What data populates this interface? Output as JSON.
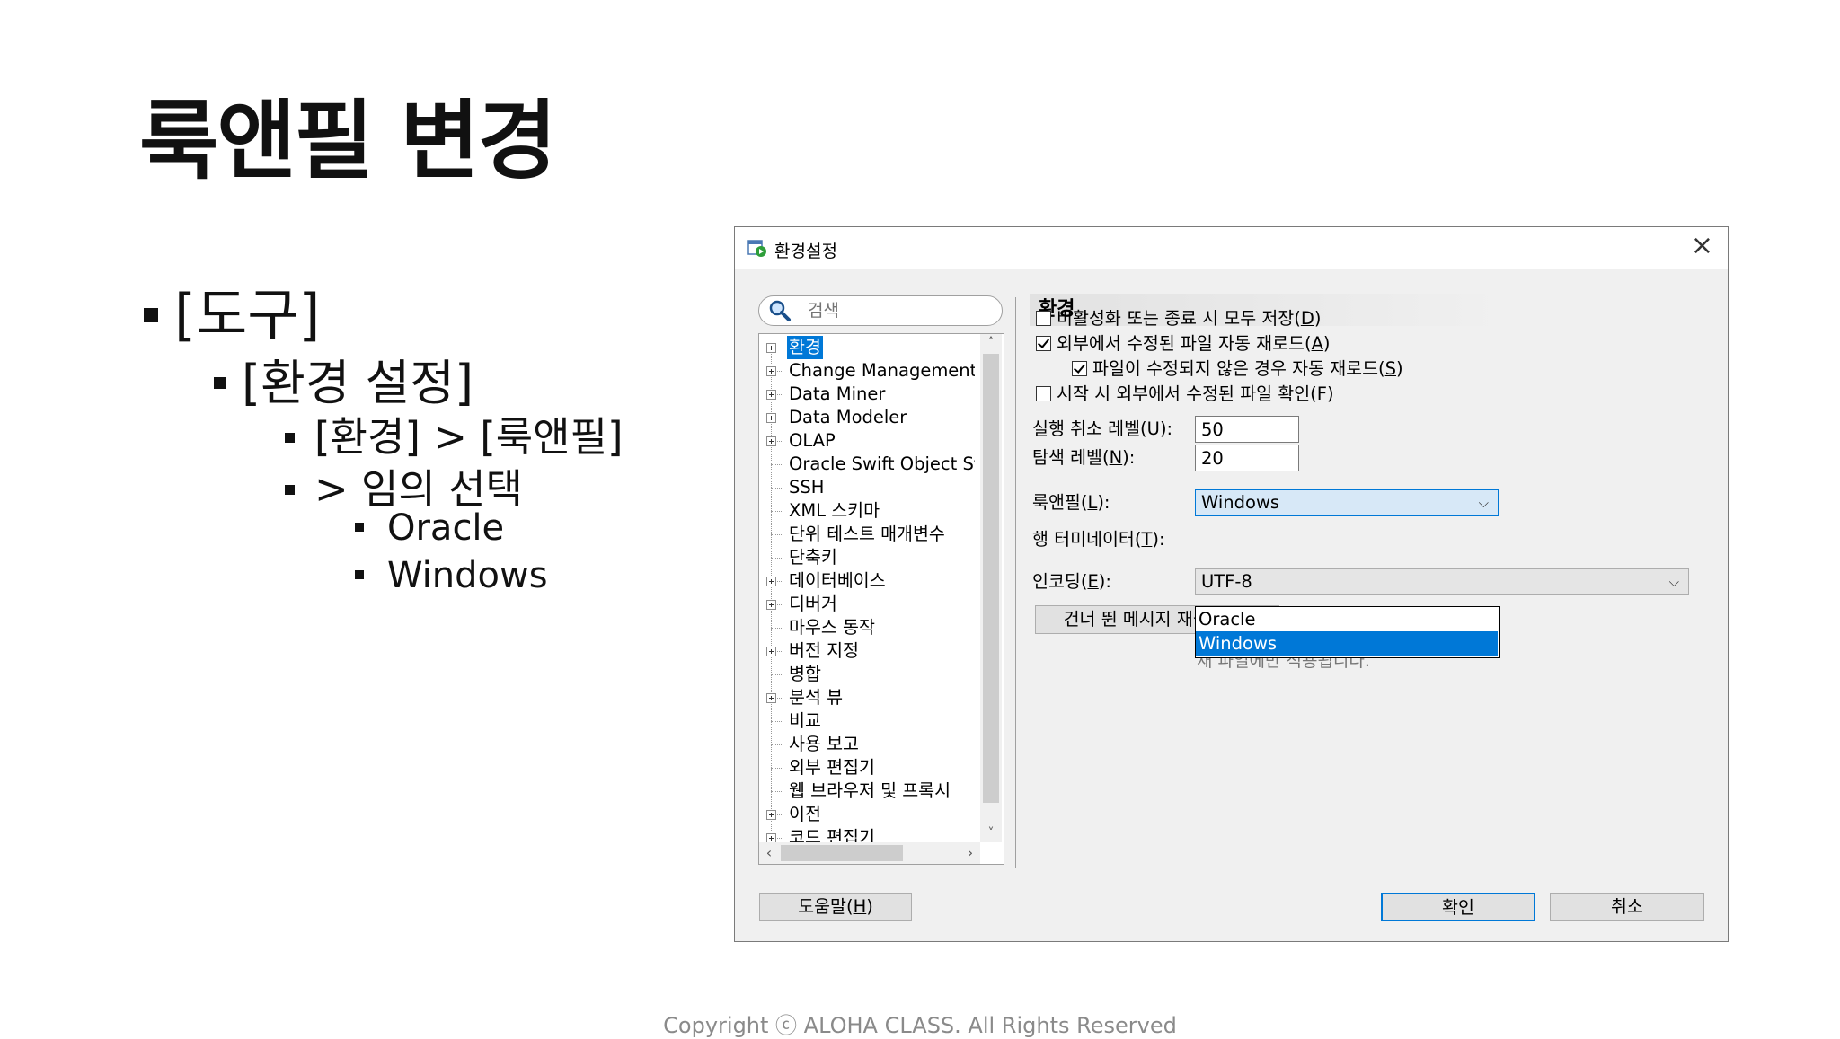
{
  "slide": {
    "title": "룩앤필 변경",
    "bullets": [
      "[도구]",
      "[환경 설정]",
      "[환경] > [룩앤필]",
      "> 임의 선택",
      "Oracle",
      "Windows"
    ],
    "copyright": "Copyright ⓒ ALOHA CLASS. All Rights Reserved"
  },
  "dialog": {
    "title": "환경설정",
    "search_placeholder": "검색",
    "tree": [
      {
        "label": "환경",
        "expandable": true,
        "selected": true
      },
      {
        "label": "Change Management Par",
        "expandable": true
      },
      {
        "label": "Data Miner",
        "expandable": true
      },
      {
        "label": "Data Modeler",
        "expandable": true
      },
      {
        "label": "OLAP",
        "expandable": true
      },
      {
        "label": "Oracle Swift Object Storage",
        "expandable": false
      },
      {
        "label": "SSH",
        "expandable": false
      },
      {
        "label": "XML 스키마",
        "expandable": false
      },
      {
        "label": "단위 테스트 매개변수",
        "expandable": false
      },
      {
        "label": "단축키",
        "expandable": false
      },
      {
        "label": "데이터베이스",
        "expandable": true
      },
      {
        "label": "디버거",
        "expandable": true
      },
      {
        "label": "마우스 동작",
        "expandable": false
      },
      {
        "label": "버전 지정",
        "expandable": true
      },
      {
        "label": "병합",
        "expandable": false
      },
      {
        "label": "분석 뷰",
        "expandable": true
      },
      {
        "label": "비교",
        "expandable": false
      },
      {
        "label": "사용 보고",
        "expandable": false
      },
      {
        "label": "외부 편집기",
        "expandable": false
      },
      {
        "label": "웹 브라우저 및 프록시",
        "expandable": false
      },
      {
        "label": "이전",
        "expandable": true
      },
      {
        "label": "코드 편집기",
        "expandable": true
      }
    ],
    "panel_title": "환경",
    "checks": [
      {
        "pre": "비활성화 또는 종료 시 모두 저장(",
        "key": "D",
        "post": ")",
        "checked": false
      },
      {
        "pre": "외부에서 수정된 파일 자동 재로드(",
        "key": "A",
        "post": ")",
        "checked": true
      },
      {
        "pre": "파일이 수정되지 않은 경우 자동 재로드(",
        "key": "S",
        "post": ")",
        "checked": true
      },
      {
        "pre": "시작 시 외부에서 수정된 파일 확인(",
        "key": "F",
        "post": ")",
        "checked": false
      }
    ],
    "undo": {
      "pre": "실행 취소 레벨(",
      "key": "U",
      "post": "):",
      "value": "50"
    },
    "nav": {
      "pre": "탐색 레벨(",
      "key": "N",
      "post": "):",
      "value": "20"
    },
    "laf": {
      "pre": "룩앤필(",
      "key": "L",
      "post": "):",
      "value": "Windows",
      "options": [
        "Oracle",
        "Windows"
      ]
    },
    "terminator": {
      "pre": "행 터미네이터(",
      "key": "T",
      "post": "):"
    },
    "terminator_note": "새 파일에만 적용됩니다.",
    "encoding": {
      "pre": "인코딩(",
      "key": "E",
      "post": "):",
      "value": "UTF-8"
    },
    "reset_btn": {
      "pre": "건너 뛴 메시지 재설정(",
      "key": "R",
      "post": ")"
    },
    "help_btn": {
      "pre": "도움말(",
      "key": "H",
      "post": ")"
    },
    "ok_btn": "확인",
    "cancel_btn": "취소"
  }
}
